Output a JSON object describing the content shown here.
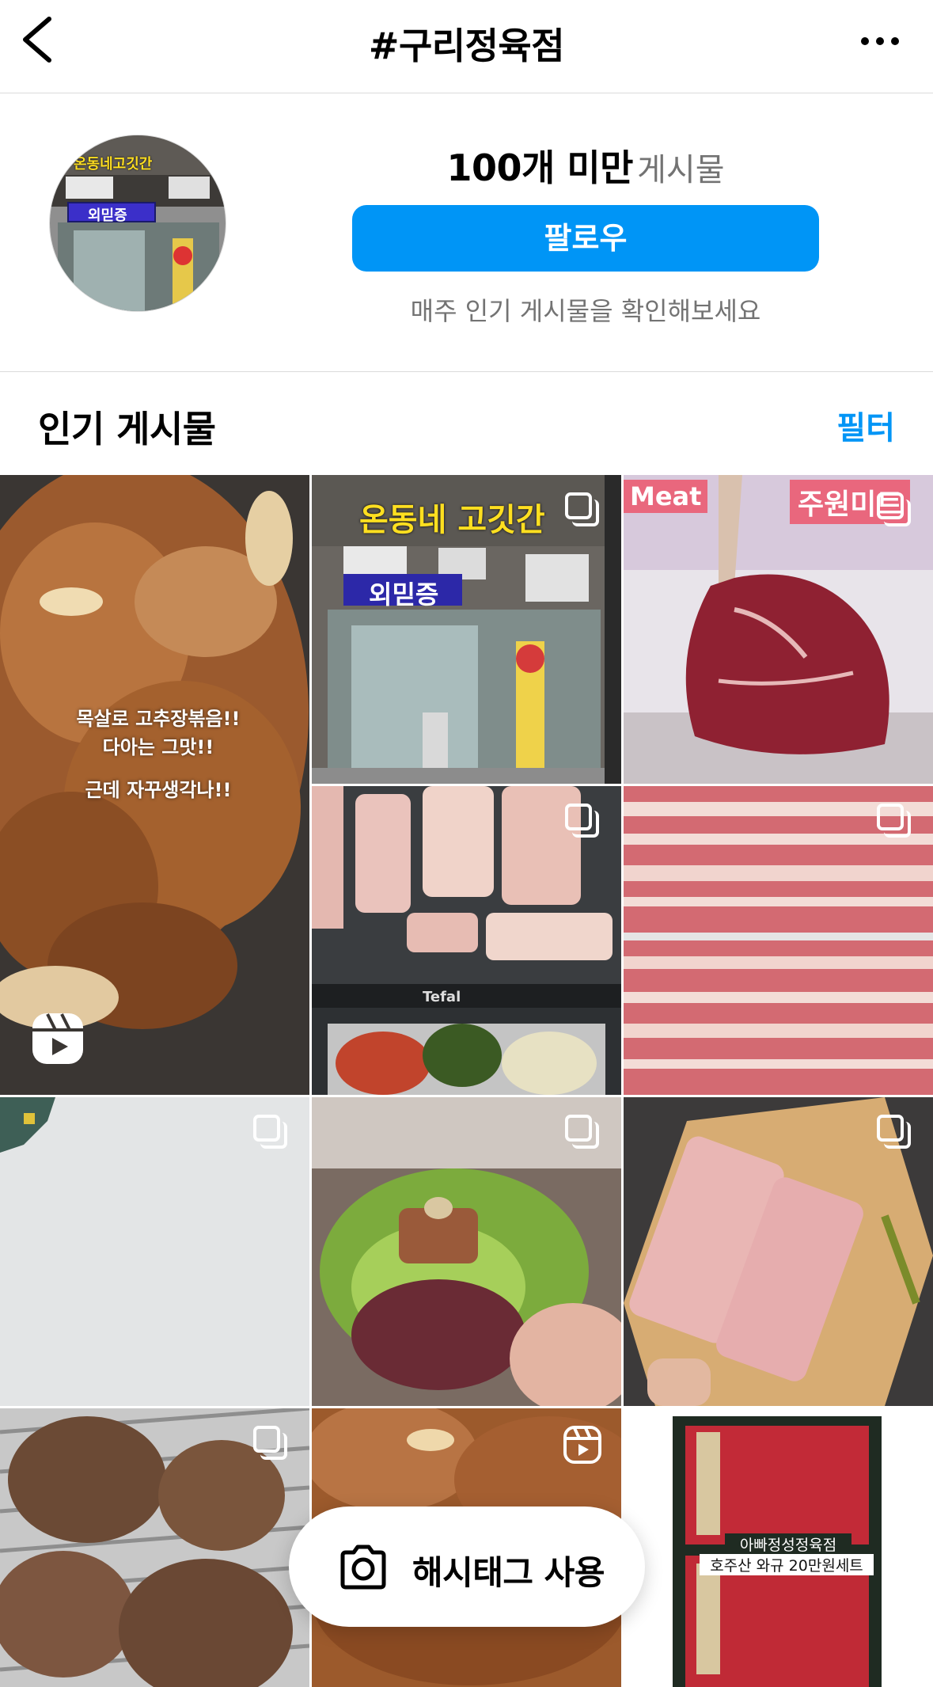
{
  "header": {
    "title": "#구리정육점",
    "back_icon": "chevron-left-icon",
    "more_icon": "ellipsis-icon"
  },
  "profile": {
    "post_count": "100개 미만",
    "post_label": "게시물",
    "follow_label": "팔로우",
    "hint": "매주 인기 게시물을 확인해보세요",
    "avatar_sign": "온동네고깃간",
    "avatar_sub": "외믿증"
  },
  "section": {
    "heading": "인기 게시물",
    "filter_label": "필터"
  },
  "tiles": [
    {
      "type": "reel",
      "caption_1": "목살로 고추장볶음!!",
      "caption_2": "다아는 그맛!!",
      "caption_3": "근데 자꾸생각나!!"
    },
    {
      "type": "carousel",
      "sign": "온동네 고깃간",
      "sub": "외믿증"
    },
    {
      "type": "carousel",
      "tag_left": "Meat",
      "tag_right": "주원미트"
    },
    {
      "type": "carousel",
      "brand": "Tefal"
    },
    {
      "type": "carousel"
    },
    {
      "type": "carousel"
    },
    {
      "type": "carousel"
    },
    {
      "type": "carousel"
    },
    {
      "type": "carousel"
    },
    {
      "type": "reel"
    },
    {
      "type": "single",
      "label_1": "아빠정성정육점",
      "label_2": "호주산 와규 20만원세트"
    }
  ],
  "floating": {
    "label": "해시태그 사용",
    "icon": "camera-icon"
  },
  "colors": {
    "accent": "#0095f6",
    "muted": "#737373"
  }
}
